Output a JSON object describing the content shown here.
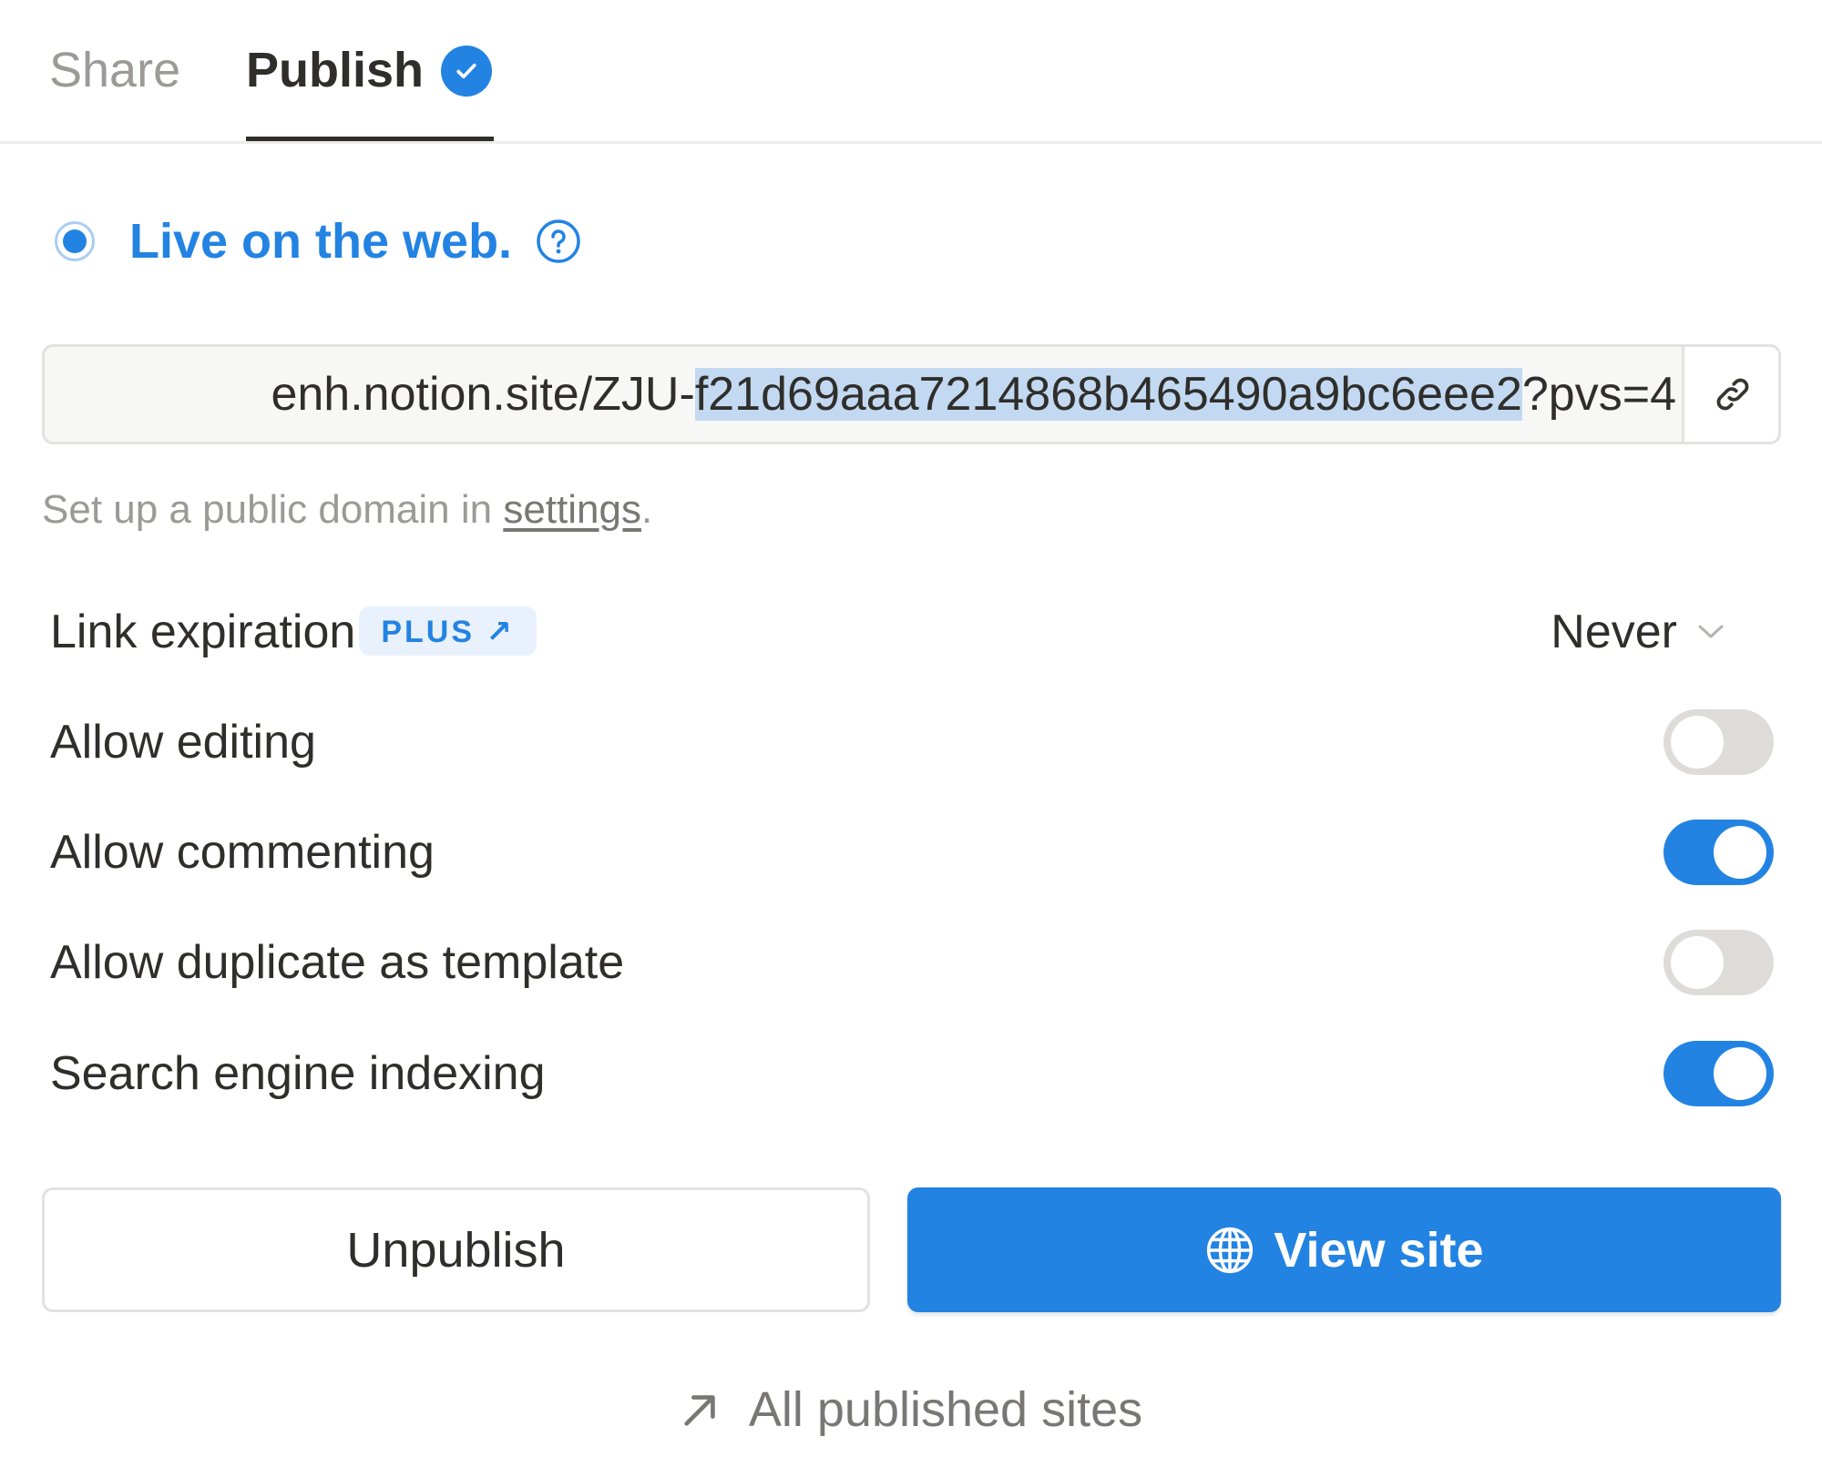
{
  "tabs": [
    {
      "label": "Share",
      "active": false
    },
    {
      "label": "Publish",
      "active": true,
      "badge_icon": "check-circle-icon"
    }
  ],
  "status": {
    "label": "Live on the web.",
    "radio_selected": true,
    "help_icon": "question-circle-icon"
  },
  "url": {
    "prefix": "enh.notion.site/ZJU-",
    "selected": "f21d69aaa7214868b465490a9bc6eee2",
    "suffix": "?pvs=4",
    "copy_icon": "link-icon"
  },
  "helper": {
    "text_before": "Set up a public domain in ",
    "link": "settings",
    "text_after": "."
  },
  "settings": {
    "link_expiration": {
      "label": "Link expiration",
      "badge": "PLUS ↗",
      "value": "Never"
    },
    "toggles": [
      {
        "label": "Allow editing",
        "on": false
      },
      {
        "label": "Allow commenting",
        "on": true
      },
      {
        "label": "Allow duplicate as template",
        "on": false
      },
      {
        "label": "Search engine indexing",
        "on": true
      }
    ]
  },
  "buttons": {
    "unpublish": "Unpublish",
    "view_site": "View site"
  },
  "footer": {
    "all_sites": "All published sites"
  },
  "colors": {
    "accent": "#2383e2",
    "text": "#2f2e2a",
    "muted": "#9b9a97",
    "toggle_off": "#dddcd9",
    "selection": "#c3d9f2"
  }
}
